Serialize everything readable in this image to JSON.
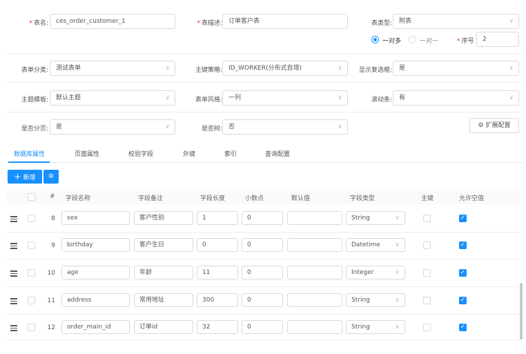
{
  "form": {
    "table_name": {
      "label": "表名:",
      "value": "ces_order_customer_1"
    },
    "table_desc": {
      "label": "表描述:",
      "value": "订单客户表"
    },
    "table_type": {
      "label": "表类型:",
      "value": "附表"
    },
    "relation": {
      "options": [
        "一对多",
        "一对一"
      ],
      "selected": "一对多"
    },
    "seq": {
      "label": "序号",
      "value": "2"
    },
    "category": {
      "label": "表单分类:",
      "value": "测试表单"
    },
    "pk_strategy": {
      "label": "主键策略:",
      "value": "ID_WORKER(分布式自增)"
    },
    "show_checkbox": {
      "label": "显示复选框:",
      "value": "是"
    },
    "theme": {
      "label": "主题模板:",
      "value": "默认主题"
    },
    "form_style": {
      "label": "表单风格:",
      "value": "一列"
    },
    "scrollbar": {
      "label": "滚动条:",
      "value": "有"
    },
    "paging": {
      "label": "是否分页:",
      "value": "是"
    },
    "is_tree": {
      "label": "是否树:",
      "value": "否"
    },
    "ext_button": "扩展配置"
  },
  "tabs": [
    "数据库属性",
    "页面属性",
    "校验字段",
    "外键",
    "索引",
    "查询配置"
  ],
  "toolbar": {
    "add_label": "新增"
  },
  "columns": [
    "#",
    "字段名称",
    "字段备注",
    "字段长度",
    "小数点",
    "默认值",
    "字段类型",
    "主键",
    "允许空值"
  ],
  "rows": [
    {
      "num": "8",
      "name": "sex",
      "remark": "客户性别",
      "length": "1",
      "decimal": "0",
      "default": "",
      "type": "String",
      "pk": false,
      "nullable": true
    },
    {
      "num": "9",
      "name": "birthday",
      "remark": "客户生日",
      "length": "0",
      "decimal": "0",
      "default": "",
      "type": "Datetime",
      "pk": false,
      "nullable": true
    },
    {
      "num": "10",
      "name": "age",
      "remark": "年龄",
      "length": "11",
      "decimal": "0",
      "default": "",
      "type": "Integer",
      "pk": false,
      "nullable": true
    },
    {
      "num": "11",
      "name": "address",
      "remark": "常用地址",
      "length": "300",
      "decimal": "0",
      "default": "",
      "type": "String",
      "pk": false,
      "nullable": true
    },
    {
      "num": "12",
      "name": "order_main_id",
      "remark": "订单id",
      "length": "32",
      "decimal": "0",
      "default": "",
      "type": "String",
      "pk": false,
      "nullable": true
    }
  ],
  "icons": {
    "chevron": "chevron-down-icon",
    "settings": "gear-icon",
    "drag": "drag-handle-icon",
    "check": "check-icon"
  },
  "colors": {
    "primary": "#1890ff",
    "required": "#f5222d"
  }
}
